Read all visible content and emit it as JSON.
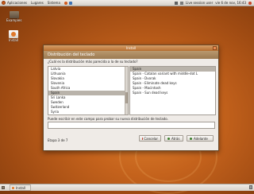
{
  "top_panel": {
    "menus": [
      "Aplicaciones",
      "Lugares",
      "Sistema"
    ],
    "live_session": "Live session user",
    "clock": "vie 6 de nov, 16:43"
  },
  "desktop": {
    "icons": [
      "Examples",
      "Install"
    ]
  },
  "window": {
    "title": "Install",
    "header": "Distribución del teclado",
    "question": "¿Cuál es la distribución más parecida a la de su teclado?",
    "countries": [
      "Latvia",
      "Lithuania",
      "Slovakia",
      "Slovenia",
      "South Africa",
      "Spain",
      "Sri Lanka",
      "Sweden",
      "Switzerland",
      "Syria"
    ],
    "selected_country": 5,
    "variants": [
      "Spain",
      "Spain - Catalan variant with middle-dot L",
      "Spain - Dvorak",
      "Spain - Eliminate dead keys",
      "Spain - Macintosh",
      "Spain - Sun dead keys"
    ],
    "selected_variant": 0,
    "test_label": "Puede escribir en este campo para probar su nueva distribución de teclado.",
    "test_value": "",
    "step": "Etapa 3 de 7",
    "buttons": {
      "cancel": "Cancelar",
      "back": "Atrás",
      "forward": "Adelante"
    }
  },
  "bottom_panel": {
    "task": "Install"
  },
  "colors": {
    "accent": "#c4621c",
    "selection": "#b9b3aa",
    "titlebar": "#b46c2f"
  }
}
